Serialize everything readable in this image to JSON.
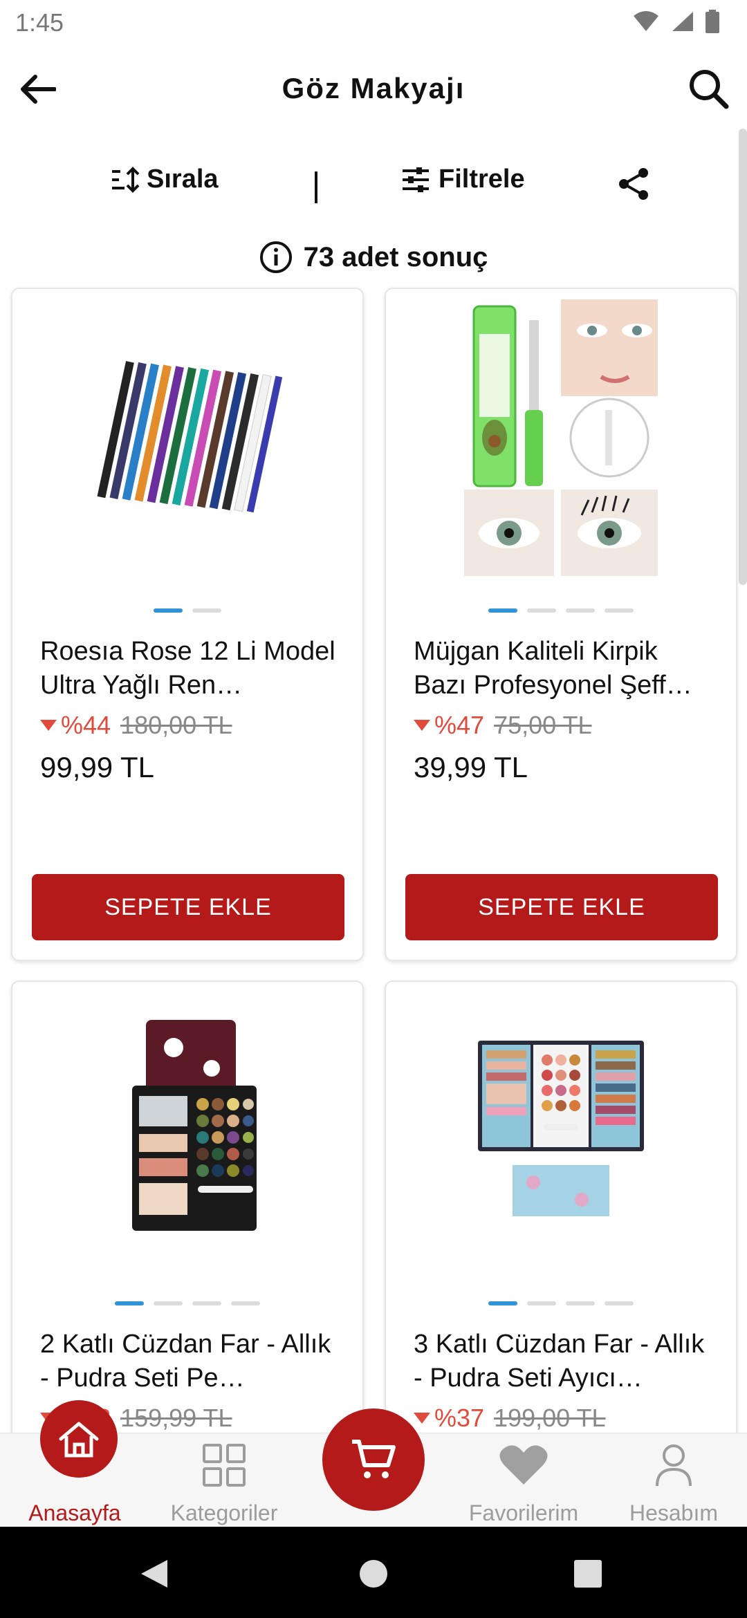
{
  "status": {
    "time": "1:45"
  },
  "header": {
    "title": "Göz Makyajı"
  },
  "toolbar": {
    "sort_label": "Sırala",
    "filter_label": "Filtrele"
  },
  "results": {
    "text": "73 adet sonuç"
  },
  "products": [
    {
      "name": "Roesıa Rose 12 Li Model Ultra Yağlı Ren…",
      "discount": "%44",
      "old_price": "180,00 TL",
      "price": "99,99 TL",
      "button": "SEPETE EKLE"
    },
    {
      "name": "Müjgan Kaliteli Kirpik Bazı Profesyonel Şeff…",
      "discount": "%47",
      "old_price": "75,00 TL",
      "price": "39,99 TL",
      "button": "SEPETE EKLE"
    },
    {
      "name": "2 Katlı Cüzdan Far - Allık - Pudra Seti Pe…",
      "discount": "%38",
      "old_price": "159,99 TL",
      "price": "",
      "button": ""
    },
    {
      "name": "3 Katlı Cüzdan Far - Allık - Pudra Seti Ayıcı…",
      "discount": "%37",
      "old_price": "199,00 TL",
      "price": "",
      "button": ""
    }
  ],
  "nav": {
    "home": "Anasayfa",
    "categories": "Kategoriler",
    "favorites": "Favorilerim",
    "account": "Hesabım"
  },
  "colors": {
    "accent": "#b41a1a",
    "discount": "#e04b3c",
    "dot_active": "#2f93d6"
  }
}
